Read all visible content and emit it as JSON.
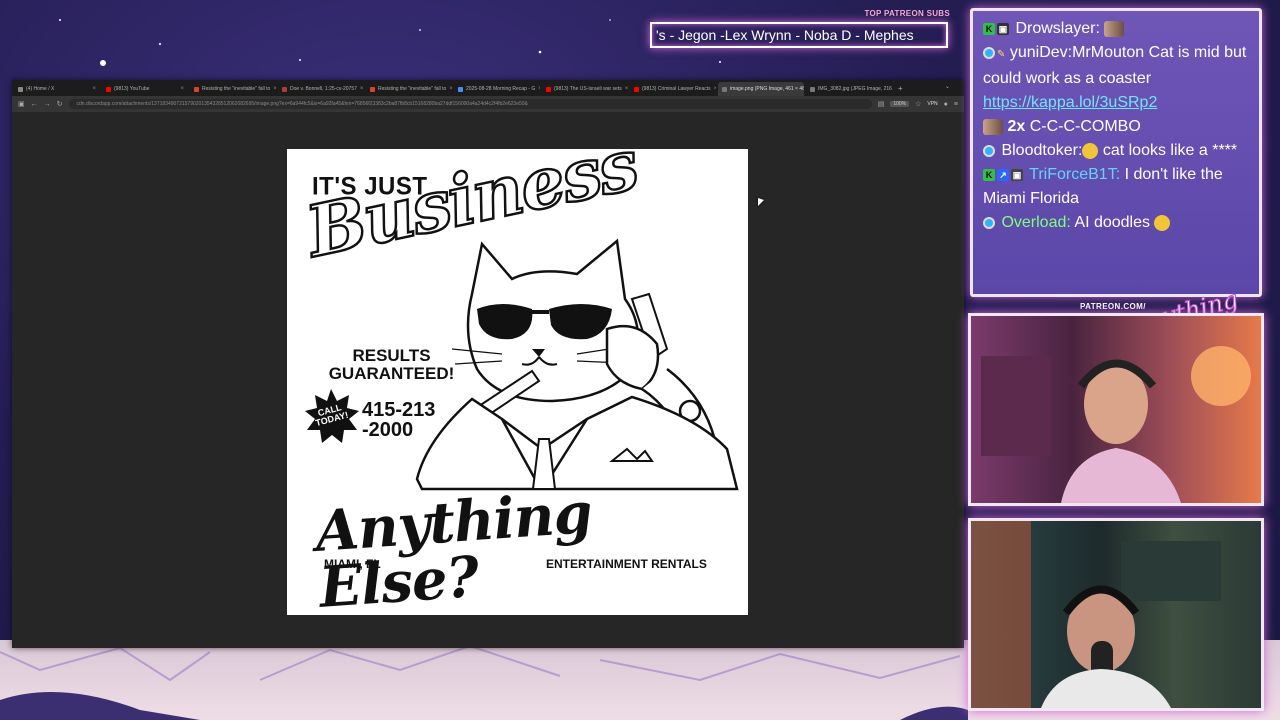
{
  "overlay": {
    "patreon_label": "TOP PATREON SUBS",
    "ticker_text": "'s - Jegon -Lex Wrynn -  Noba D - Mephes",
    "patreon_url": "PATREON.COM/",
    "logo_text": "Anything Else?"
  },
  "browser": {
    "tabs": [
      {
        "label": "(4) Home / X",
        "color": "#888888"
      },
      {
        "label": "(9813) YouTube",
        "color": "#ff0000"
      },
      {
        "label": "Resisting the \"inevitable\" fall to",
        "color": "#e0402a"
      },
      {
        "label": "Doe v. Bonnell, 1:25-cv-20757",
        "color": "#b23a3a"
      },
      {
        "label": "Resisting the \"inevitable\" fall to",
        "color": "#e0402a"
      },
      {
        "label": "2025-08-28 Morning Recap - G",
        "color": "#4a8df7"
      },
      {
        "label": "(9813) The US-Israeli war sets",
        "color": "#ff0000"
      },
      {
        "label": "(9813) Criminal Lawyer Reacts",
        "color": "#ff0000"
      },
      {
        "label": "image.png (PNG Image, 461 × 46",
        "color": "#777777"
      },
      {
        "label": "IMG_3082.jpg (JPEG Image, 2160 ×",
        "color": "#777777"
      }
    ],
    "active_tab_index": 8,
    "url": "cdn.discordapp.com/attachments/1371834907215790201354328512062082695/image.png?ex=6a944fc5&is=6a92fa45&hm=76856f23383c2ba87fb8cb15168280ba27ddf156000a4a24d4c2f4fb2e623e50&",
    "zoom": "100%",
    "vpn": "VPN"
  },
  "poster": {
    "line1": "IT'S JUST",
    "headline": "Business",
    "results_line1": "RESULTS",
    "results_line2": "GUARANTEED!",
    "call_line1": "CALL",
    "call_line2": "TODAY!",
    "phone_line1": "415-213",
    "phone_line2": "-2000",
    "tagline": "Anything Else?",
    "city": "MIAMI, FL",
    "service": "ENTERTAINMENT RENTALS"
  },
  "chat": {
    "messages": [
      {
        "user": "Drowslayer:",
        "text": "",
        "user_color": "#ffffff"
      },
      {
        "user": "yuniDev:",
        "text": "MrMouton  Cat is mid but could work as a coaster",
        "link": "https://kappa.lol/3uSRp2",
        "user_color": "#ffffff"
      },
      {
        "combo_mult": "2x",
        "combo_text": "C-C-C-COMBO"
      },
      {
        "user": "Bloodtoker:",
        "text": " cat looks like a ****",
        "user_color": "#ffffff"
      },
      {
        "user": "TriForceB1T:",
        "text": " I don't like the Miami Florida",
        "user_color": "#63d3ff"
      },
      {
        "user": "Overload:",
        "text": " AI doodles",
        "user_color": "#7dff7d"
      }
    ]
  }
}
